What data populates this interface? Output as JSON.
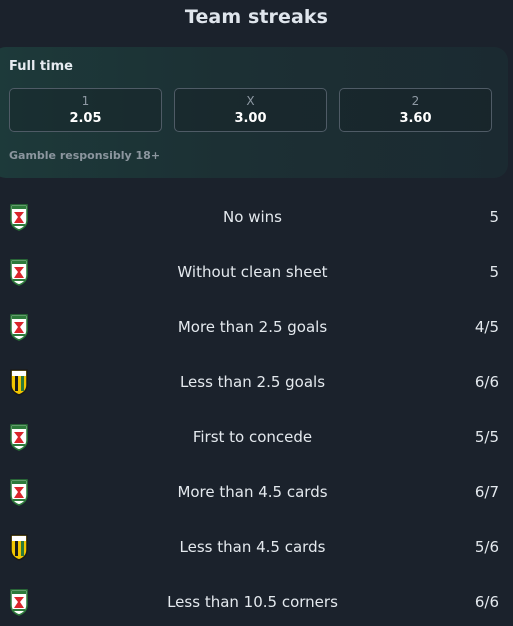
{
  "page": {
    "title": "Team streaks"
  },
  "odds": {
    "label": "Full time",
    "options": [
      {
        "label": "1",
        "value": "2.05"
      },
      {
        "label": "X",
        "value": "3.00"
      },
      {
        "label": "2",
        "value": "3.60"
      }
    ],
    "disclaimer": "Gamble responsibly 18+"
  },
  "streaks": [
    {
      "team_icon": "red-white-crest-icon",
      "text": "No wins",
      "count": "5"
    },
    {
      "team_icon": "red-white-crest-icon",
      "text": "Without clean sheet",
      "count": "5"
    },
    {
      "team_icon": "red-white-crest-icon",
      "text": "More than 2.5 goals",
      "count": "4/5"
    },
    {
      "team_icon": "yellow-black-crest-icon",
      "text": "Less than 2.5 goals",
      "count": "6/6"
    },
    {
      "team_icon": "red-white-crest-icon",
      "text": "First to concede",
      "count": "5/5"
    },
    {
      "team_icon": "red-white-crest-icon",
      "text": "More than 4.5 cards",
      "count": "6/7"
    },
    {
      "team_icon": "yellow-black-crest-icon",
      "text": "Less than 4.5 cards",
      "count": "5/6"
    },
    {
      "team_icon": "red-white-crest-icon",
      "text": "Less than 10.5 corners",
      "count": "6/6"
    }
  ],
  "colors": {
    "background": "#1b222c",
    "card_gradient_start": "#1d3a3a",
    "home_crest": "#d9262b",
    "away_crest": "#f2c500"
  }
}
